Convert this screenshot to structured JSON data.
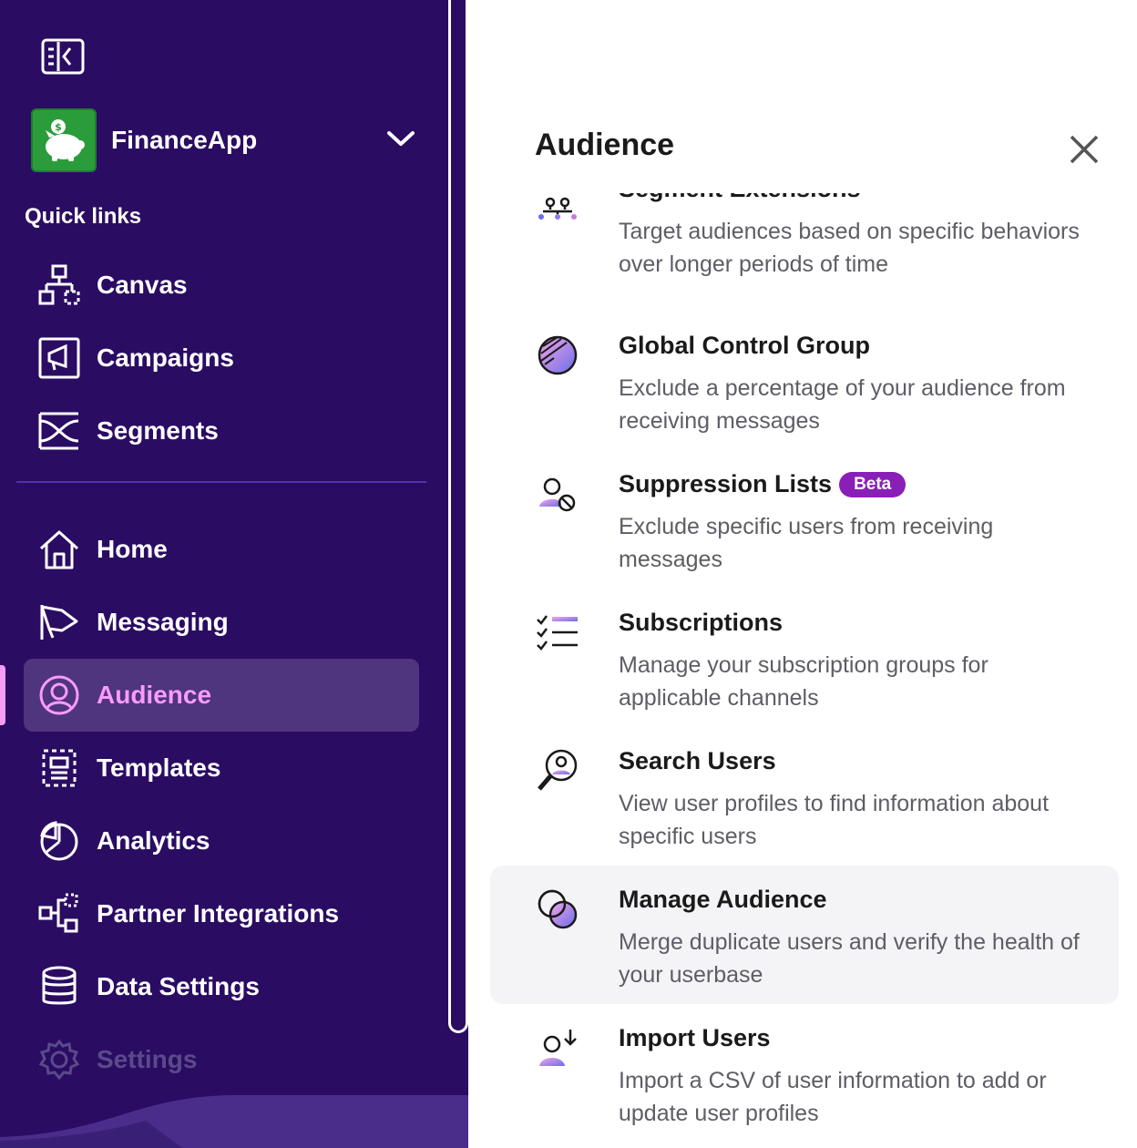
{
  "workspace": {
    "name": "FinanceApp",
    "logo_color": "#2a9d3a"
  },
  "sidebar": {
    "quick_links_label": "Quick links",
    "quick_links": [
      {
        "label": "Canvas",
        "icon": "canvas-icon"
      },
      {
        "label": "Campaigns",
        "icon": "campaigns-icon"
      },
      {
        "label": "Segments",
        "icon": "segments-icon"
      }
    ],
    "nav": [
      {
        "label": "Home",
        "icon": "home-icon"
      },
      {
        "label": "Messaging",
        "icon": "messaging-icon"
      },
      {
        "label": "Audience",
        "icon": "audience-icon",
        "active": true
      },
      {
        "label": "Templates",
        "icon": "templates-icon"
      },
      {
        "label": "Analytics",
        "icon": "analytics-icon"
      },
      {
        "label": "Partner Integrations",
        "icon": "partner-integrations-icon"
      },
      {
        "label": "Data Settings",
        "icon": "data-settings-icon"
      },
      {
        "label": "Settings",
        "icon": "settings-icon"
      }
    ],
    "colors": {
      "background": "#2a0c63",
      "active_bg": "#4f347e",
      "active_text": "#f79cf7"
    }
  },
  "panel": {
    "title": "Audience",
    "items": [
      {
        "title": "Segment Extensions",
        "description": "Target audiences based on specific behaviors over longer periods of time",
        "icon": "segment-extensions-icon"
      },
      {
        "title": "Global Control Group",
        "description": "Exclude a percentage of your audience from receiving messages",
        "icon": "global-control-group-icon"
      },
      {
        "title": "Suppression Lists",
        "badge": "Beta",
        "description": "Exclude specific users from receiving messages",
        "icon": "suppression-lists-icon"
      },
      {
        "title": "Subscriptions",
        "description": "Manage your subscription groups for applicable channels",
        "icon": "subscriptions-icon"
      },
      {
        "title": "Search Users",
        "description": "View user profiles to find information about specific users",
        "icon": "search-users-icon"
      },
      {
        "title": "Manage Audience",
        "description": "Merge duplicate users and verify the health of your userbase",
        "icon": "manage-audience-icon",
        "highlighted": true
      },
      {
        "title": "Import Users",
        "description": "Import a CSV of user information to add or update user profiles",
        "icon": "import-users-icon"
      }
    ]
  }
}
